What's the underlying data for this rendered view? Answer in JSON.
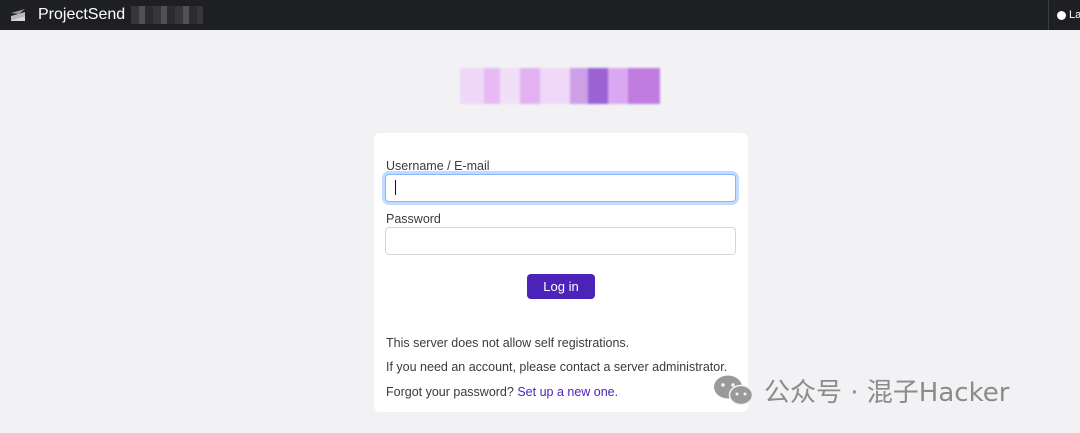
{
  "header": {
    "app_name": "ProjectSend",
    "language_label": "La",
    "icons": [
      "projectsend-logo-icon",
      "globe-icon"
    ]
  },
  "login": {
    "username_label": "Username / E-mail",
    "username_value": "",
    "password_label": "Password",
    "password_value": "",
    "submit_label": "Log in",
    "no_registration_text": "This server does not allow self registrations.",
    "contact_admin_text": "If you need an account, please contact a server administrator.",
    "forgot_text": "Forgot your password?",
    "reset_link": "Set up a new one."
  },
  "watermark": {
    "text": "公众号 · 混子Hacker",
    "icon": "wechat-icon"
  },
  "colors": {
    "topbar": "#1e1f22",
    "background": "#f2f2f5",
    "accent": "#4b23b8",
    "focus_border": "#86b7fe"
  }
}
